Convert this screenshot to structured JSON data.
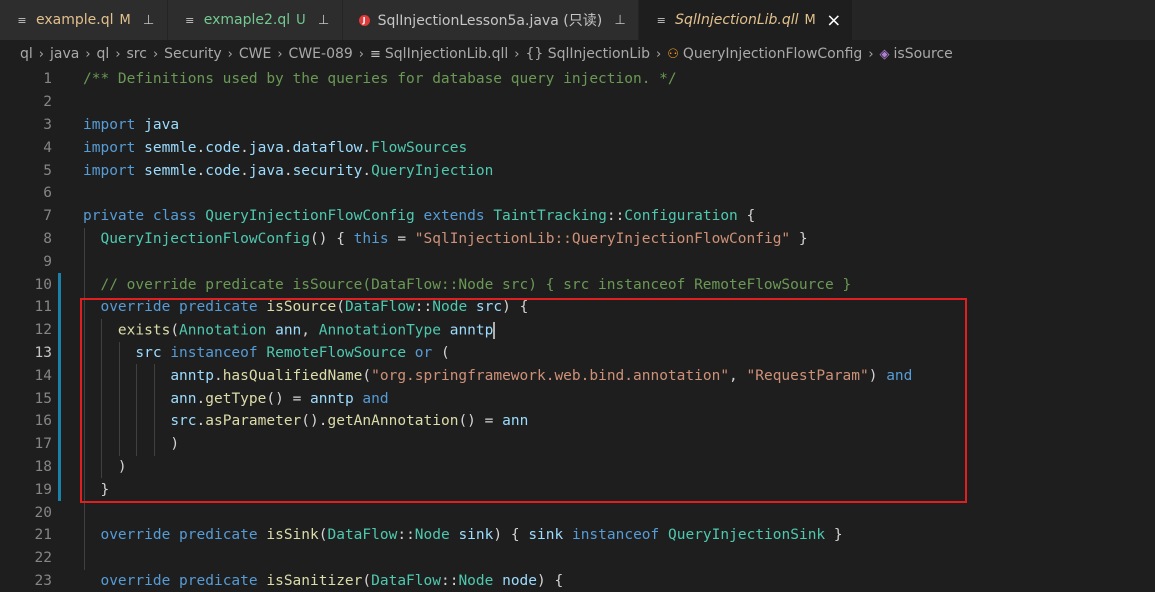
{
  "tabs": [
    {
      "icon": "menu-lines-icon",
      "name": "example.ql",
      "status": "M",
      "pinned": true,
      "active": false,
      "style": "modified"
    },
    {
      "icon": "menu-lines-icon",
      "name": "exmaple2.ql",
      "status": "U",
      "pinned": true,
      "active": false,
      "style": "untracked"
    },
    {
      "icon": "java-icon",
      "name": "SqlInjectionLesson5a.java (只读)",
      "status": "",
      "pinned": true,
      "active": false,
      "style": "plain"
    },
    {
      "icon": "menu-lines-icon",
      "name": "SqlInjectionLib.qll",
      "status": "M",
      "pinned": false,
      "active": true,
      "style": "italic"
    }
  ],
  "breadcrumb": [
    "ql",
    "java",
    "ql",
    "src",
    "Security",
    "CWE",
    "CWE-089",
    "SqlInjectionLib.qll",
    "{} SqlInjectionLib",
    "QueryInjectionFlowConfig",
    "isSource"
  ],
  "code_lines": [
    {
      "n": "1",
      "text": "/** Definitions used by the queries for database query injection. */"
    },
    {
      "n": "2",
      "text": ""
    },
    {
      "n": "3",
      "text": "import java"
    },
    {
      "n": "4",
      "text": "import semmle.code.java.dataflow.FlowSources"
    },
    {
      "n": "5",
      "text": "import semmle.code.java.security.QueryInjection"
    },
    {
      "n": "6",
      "text": ""
    },
    {
      "n": "7",
      "text": "private class QueryInjectionFlowConfig extends TaintTracking::Configuration {"
    },
    {
      "n": "8",
      "text": "  QueryInjectionFlowConfig() { this = \"SqlInjectionLib::QueryInjectionFlowConfig\" }"
    },
    {
      "n": "9",
      "text": ""
    },
    {
      "n": "10",
      "text": "  // override predicate isSource(DataFlow::Node src) { src instanceof RemoteFlowSource }"
    },
    {
      "n": "11",
      "text": "  override predicate isSource(DataFlow::Node src) {"
    },
    {
      "n": "12",
      "text": "    exists(Annotation ann, AnnotationType anntp"
    },
    {
      "n": "13",
      "text": "      src instanceof RemoteFlowSource or ("
    },
    {
      "n": "14",
      "text": "          anntp.hasQualifiedName(\"org.springframework.web.bind.annotation\", \"RequestParam\") and"
    },
    {
      "n": "15",
      "text": "          ann.getType() = anntp and"
    },
    {
      "n": "16",
      "text": "          src.asParameter().getAnAnnotation() = ann"
    },
    {
      "n": "17",
      "text": "          )"
    },
    {
      "n": "18",
      "text": "    )"
    },
    {
      "n": "19",
      "text": "  }"
    },
    {
      "n": "20",
      "text": ""
    },
    {
      "n": "21",
      "text": "  override predicate isSink(DataFlow::Node sink) { sink instanceof QueryInjectionSink }"
    },
    {
      "n": "22",
      "text": ""
    },
    {
      "n": "23",
      "text": "  override predicate isSanitizer(DataFlow::Node node) {"
    }
  ],
  "current_line": "13",
  "colors": {
    "keyword": "#569cd6",
    "control": "#c586c0",
    "type": "#4ec9b0",
    "function": "#dcdcaa",
    "variable": "#9cdcfe",
    "string": "#ce9178",
    "comment": "#6a9955",
    "highlight_box": "#e02020"
  }
}
